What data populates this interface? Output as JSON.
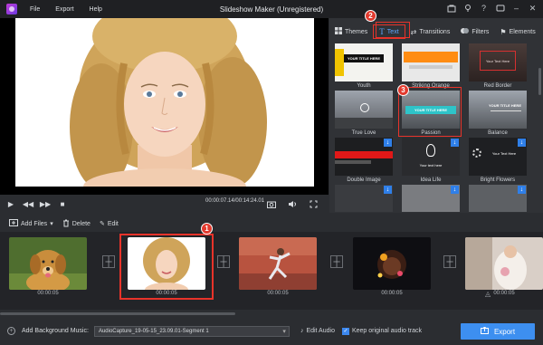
{
  "app": {
    "title": "Slideshow Maker (Unregistered)",
    "menu": [
      "File",
      "Export",
      "Help"
    ]
  },
  "player": {
    "timecode": "00:00:07.14/00:14:24.01",
    "progress": 0.02
  },
  "panel": {
    "tabs": [
      {
        "label": "Themes",
        "icon": "grid-icon"
      },
      {
        "label": "Text",
        "icon": "text-icon",
        "active": true
      },
      {
        "label": "Transitions",
        "icon": "transitions-icon"
      },
      {
        "label": "Filters",
        "icon": "filters-icon"
      },
      {
        "label": "Elements",
        "icon": "elements-icon"
      }
    ],
    "templates": [
      {
        "label": "Youth",
        "overlay": "YOUR TITLE HERE"
      },
      {
        "label": "Striking Orange",
        "overlay": ""
      },
      {
        "label": "Red Border",
        "overlay": "Your Text Here"
      },
      {
        "label": "True Love",
        "overlay": ""
      },
      {
        "label": "Passion",
        "overlay": "YOUR TITLE HERE"
      },
      {
        "label": "Balance",
        "overlay": "YOUR TITLE HERE"
      },
      {
        "label": "Double Image",
        "overlay": ""
      },
      {
        "label": "Idea Life",
        "overlay": "Your text here"
      },
      {
        "label": "Bright Flowers",
        "overlay": "Your Text Here"
      }
    ]
  },
  "toolbar": {
    "add_files": "Add Files",
    "delete": "Delete",
    "edit": "Edit"
  },
  "timeline": {
    "clips": [
      {
        "time": "00:00:05"
      },
      {
        "time": "00:00:05"
      },
      {
        "time": "00:00:05"
      },
      {
        "time": "00:00:05"
      },
      {
        "time": "00:00:05"
      }
    ]
  },
  "bottom": {
    "bgm_label": "Add Background Music:",
    "bgm_value": "AudioCapture_19-05-15_23.09.01-Segment 1",
    "edit_audio": "Edit Audio",
    "keep_audio": "Keep original audio track",
    "export": "Export"
  },
  "callouts": [
    "1",
    "2",
    "3"
  ],
  "colors": {
    "accent": "#3d8ff0",
    "callout": "#e23a2e",
    "active_tab_text": "#5ea6ff"
  }
}
